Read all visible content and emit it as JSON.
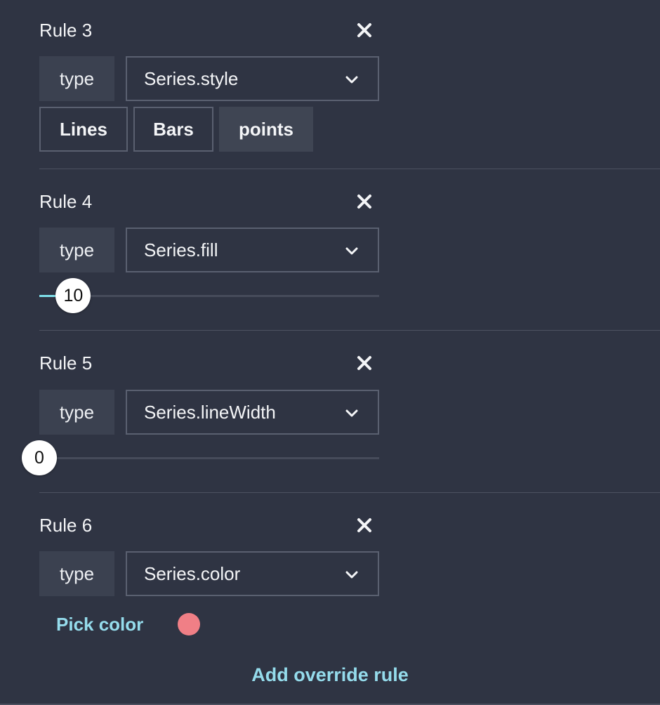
{
  "rules": [
    {
      "title": "Rule 3",
      "type_label": "type",
      "selected_type": "Series.style",
      "options": [
        "Lines",
        "Bars",
        "points"
      ],
      "active_option": "points"
    },
    {
      "title": "Rule 4",
      "type_label": "type",
      "selected_type": "Series.fill",
      "slider_value": "10",
      "slider_fraction": 0.1
    },
    {
      "title": "Rule 5",
      "type_label": "type",
      "selected_type": "Series.lineWidth",
      "slider_value": "0",
      "slider_fraction": 0.0
    },
    {
      "title": "Rule 6",
      "type_label": "type",
      "selected_type": "Series.color",
      "pick_color_label": "Pick color",
      "color": "#f07f86"
    }
  ],
  "add_rule_label": "Add override rule",
  "icons": {
    "close": "close-icon",
    "dropdown": "chevron-down-icon"
  },
  "colors": {
    "background": "#2f3443",
    "accent": "#95dcec",
    "slider_fill": "#7fe0ea"
  }
}
